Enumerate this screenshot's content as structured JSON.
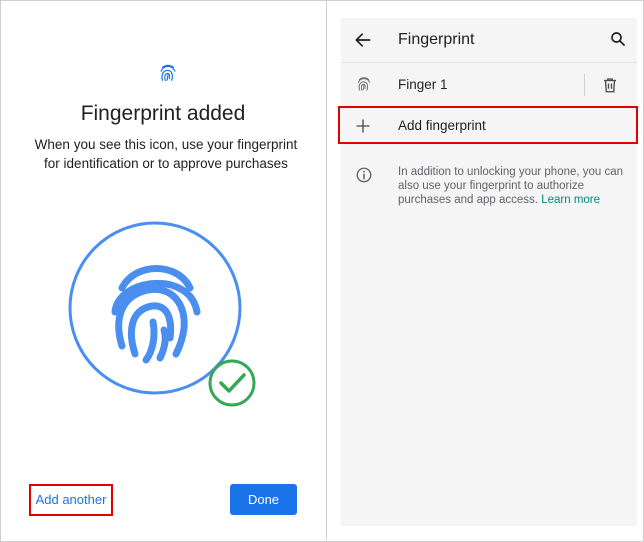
{
  "left": {
    "title": "Fingerprint added",
    "description": "When you see this icon, use your fingerprint for identification or to approve purchases",
    "add_another_label": "Add another",
    "done_label": "Done"
  },
  "right": {
    "title": "Fingerprint",
    "fingerprints": [
      {
        "label": "Finger 1"
      }
    ],
    "add_fingerprint_label": "Add fingerprint",
    "info_text": "In addition to unlocking your phone, you can also use your fingerprint to authorize purchases and app access.",
    "learn_more": "Learn more"
  },
  "colors": {
    "accent": "#1a73e8",
    "check": "#34a853",
    "highlight": "#e00000",
    "link": "#00897b"
  },
  "icons": [
    "fingerprint-icon",
    "back-arrow-icon",
    "search-icon",
    "trash-icon",
    "plus-icon",
    "info-icon",
    "check-circle-icon"
  ]
}
